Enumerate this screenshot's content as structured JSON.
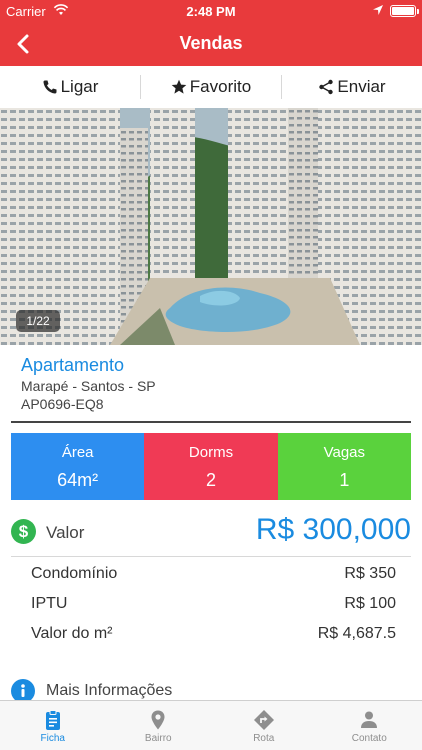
{
  "status_bar": {
    "carrier": "Carrier",
    "time": "2:48 PM"
  },
  "nav": {
    "title": "Vendas"
  },
  "actions": {
    "call": "Ligar",
    "favorite": "Favorito",
    "share": "Enviar"
  },
  "photo": {
    "counter": "1/22"
  },
  "listing": {
    "type": "Apartamento",
    "address": "Marapé - Santos - SP",
    "code": "AP0696-EQ8"
  },
  "stats": {
    "area_label": "Área",
    "area_value": "64m²",
    "dorms_label": "Dorms",
    "dorms_value": "2",
    "vagas_label": "Vagas",
    "vagas_value": "1"
  },
  "price": {
    "label": "Valor",
    "value": "R$ 300,000"
  },
  "costs": [
    {
      "label": "Condomínio",
      "value": "R$ 350"
    },
    {
      "label": "IPTU",
      "value": "R$ 100"
    },
    {
      "label": "Valor do m²",
      "value": "R$ 4,687.5"
    }
  ],
  "more_info": {
    "label": "Mais Informações"
  },
  "tabs": [
    {
      "label": "Ficha",
      "icon": "clipboard-icon",
      "active": true
    },
    {
      "label": "Bairro",
      "icon": "map-pin-icon",
      "active": false
    },
    {
      "label": "Rota",
      "icon": "route-sign-icon",
      "active": false
    },
    {
      "label": "Contato",
      "icon": "person-icon",
      "active": false
    }
  ],
  "colors": {
    "brand_red": "#e83a3c",
    "accent_blue": "#1a8be0",
    "area_blue": "#2d8ef0",
    "dorms_red": "#f03a55",
    "vagas_green": "#5ad23d",
    "money_green": "#32b551"
  }
}
